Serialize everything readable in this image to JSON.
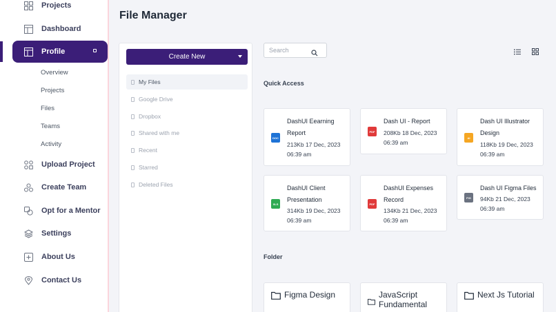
{
  "sidebar": {
    "items": [
      {
        "label": "Projects",
        "icon": "grid-icon"
      },
      {
        "label": "Dashboard",
        "icon": "layout-icon"
      },
      {
        "label": "Profile",
        "icon": "layout-icon",
        "active": true
      },
      {
        "label": "Upload Project",
        "icon": "apps-icon"
      },
      {
        "label": "Create Team",
        "icon": "team-icon"
      },
      {
        "label": "Opt for a Mentor",
        "icon": "mentor-icon"
      },
      {
        "label": "Settings",
        "icon": "layers-icon"
      },
      {
        "label": "About Us",
        "icon": "plus-square-icon"
      },
      {
        "label": "Contact Us",
        "icon": "location-icon"
      }
    ],
    "submenu": [
      "Overview",
      "Projects",
      "Files",
      "Teams",
      "Activity"
    ]
  },
  "page": {
    "title": "File Manager"
  },
  "files_panel": {
    "create_label": "Create New",
    "links": [
      "My Files",
      "Google Drive",
      "Dropbox",
      "Shared with me",
      "Recent",
      "Starred",
      "Deleted Files"
    ]
  },
  "search": {
    "placeholder": "Search"
  },
  "quick_access": {
    "label": "Quick Access",
    "cards": [
      {
        "name_lines": [
          "DashUI Eearning",
          "Report"
        ],
        "meta_lines": [
          "213Kb  17 Dec, 2023",
          "06:39 am"
        ],
        "type": "DOC",
        "color": "#1e73d6"
      },
      {
        "name_lines": [
          "Dash UI - Report"
        ],
        "meta_lines": [
          "208Kb  18 Dec, 2023",
          "06:39 am"
        ],
        "type": "PDF",
        "color": "#e03a3a"
      },
      {
        "name_lines": [
          "Dash UI Illustrator",
          "Design"
        ],
        "meta_lines": [
          "118Kb  19 Dec, 2023",
          "06:39 am"
        ],
        "type": "AI",
        "color": "#f5a623"
      },
      {
        "name_lines": [
          "DashUI Client",
          "Presentation"
        ],
        "meta_lines": [
          "314Kb  19 Dec, 2023",
          "06:39 am"
        ],
        "type": "XLS",
        "color": "#2eaa52"
      },
      {
        "name_lines": [
          "DashUI Expenses",
          "Record"
        ],
        "meta_lines": [
          "134Kb  21 Dec, 2023",
          "06:39 am"
        ],
        "type": "PDF",
        "color": "#e03a3a"
      },
      {
        "name_lines": [
          "Dash UI Figma Files"
        ],
        "meta_lines": [
          "94Kb  21 Dec, 2023",
          "06:39 am"
        ],
        "type": "FIG",
        "color": "#6b7280"
      }
    ]
  },
  "folders": {
    "label": "Folder",
    "items": [
      {
        "name_lines": [
          "Figma Design"
        ]
      },
      {
        "name_lines": [
          "JavaScript",
          "Fundamental"
        ]
      },
      {
        "name_lines": [
          "Next Js Tutorial"
        ]
      }
    ]
  }
}
